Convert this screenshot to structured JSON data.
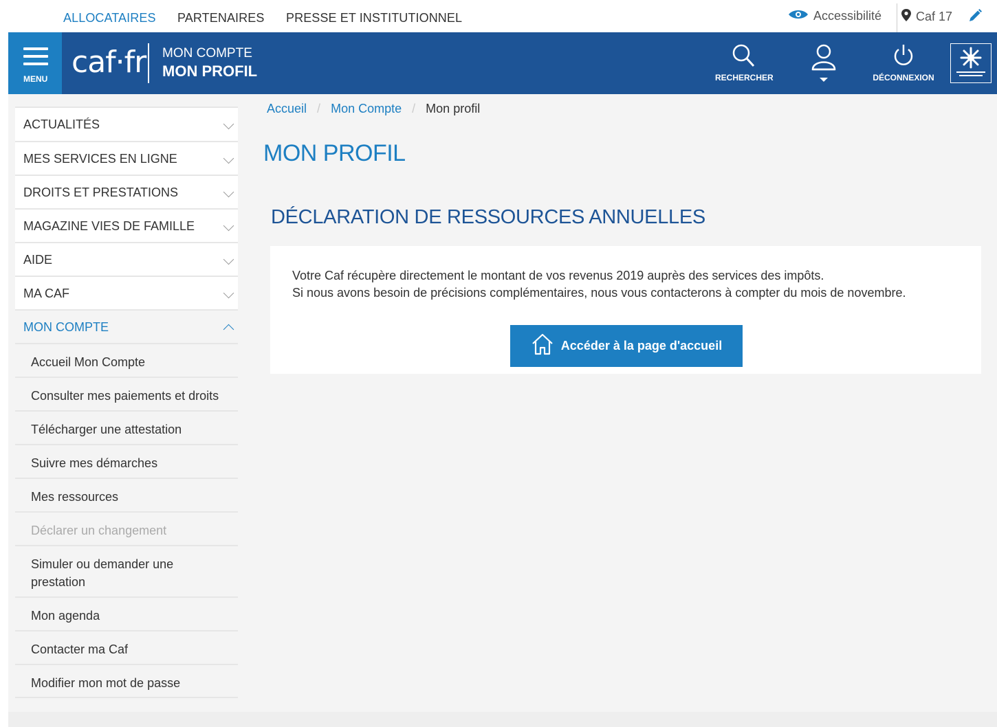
{
  "top_nav": {
    "items": [
      {
        "label": "ALLOCATAIRES",
        "active": true
      },
      {
        "label": "PARTENAIRES",
        "active": false
      },
      {
        "label": "PRESSE ET INSTITUTIONNEL",
        "active": false
      }
    ],
    "accessibility_label": "Accessibilité",
    "location_label": "Caf 17",
    "icons": {
      "accessibility": "eye-sign-icon",
      "location": "map-pin-icon",
      "edit": "pencil-icon"
    }
  },
  "header": {
    "menu_label": "MENU",
    "logo_text": "caf·fr",
    "section_line1": "MON COMPTE",
    "section_line2": "MON PROFIL",
    "search_label": "RECHERCHER",
    "logout_label": "DÉCONNEXION",
    "colors": {
      "header_bg": "#1d5496",
      "accent": "#1d7fc2"
    }
  },
  "sidebar": {
    "items": [
      {
        "label": "ACTUALITÉS"
      },
      {
        "label": "MES SERVICES EN LIGNE"
      },
      {
        "label": "DROITS ET PRESTATIONS"
      },
      {
        "label": "MAGAZINE VIES DE FAMILLE"
      },
      {
        "label": "AIDE"
      },
      {
        "label": "MA CAF"
      },
      {
        "label": "MON COMPTE"
      }
    ],
    "sub_items": [
      {
        "label": "Accueil Mon Compte"
      },
      {
        "label": "Consulter mes paiements et droits"
      },
      {
        "label": "Télécharger une attestation"
      },
      {
        "label": "Suivre mes démarches"
      },
      {
        "label": "Mes ressources"
      },
      {
        "label": "Déclarer un changement"
      },
      {
        "label": "Simuler ou demander une prestation"
      },
      {
        "label": "Mon agenda"
      },
      {
        "label": "Contacter ma Caf"
      },
      {
        "label": "Modifier mon mot de passe"
      }
    ]
  },
  "breadcrumb": {
    "home": "Accueil",
    "account": "Mon Compte",
    "current": "Mon profil",
    "separator": "/"
  },
  "main": {
    "page_title": "MON PROFIL",
    "section_title": "DÉCLARATION DE RESSOURCES ANNUELLES",
    "paragraph1": "Votre Caf récupère directement le montant de vos revenus 2019 auprès des services des impôts.",
    "paragraph2": "Si nous avons besoin de précisions complémentaires, nous vous contacterons à compter du mois de novembre.",
    "cta_label": "Accéder à la page d'accueil"
  }
}
